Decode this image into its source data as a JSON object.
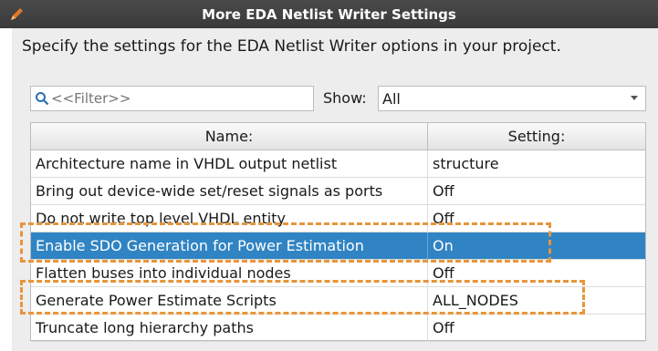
{
  "window": {
    "title": "More EDA Netlist Writer Settings"
  },
  "description": "Specify the settings for the EDA Netlist Writer options in your project.",
  "filter": {
    "placeholder": "<<Filter>>"
  },
  "show": {
    "label": "Show:",
    "selected": "All"
  },
  "table": {
    "columns": {
      "name": "Name:",
      "setting": "Setting:"
    },
    "rows": [
      {
        "name": "Architecture name in VHDL output netlist",
        "setting": "structure",
        "selected": false
      },
      {
        "name": "Bring out device-wide set/reset signals as ports",
        "setting": "Off",
        "selected": false
      },
      {
        "name": "Do not write top level VHDL entity",
        "setting": "Off",
        "selected": false
      },
      {
        "name": "Enable SDO Generation for Power Estimation",
        "setting": "On",
        "selected": true
      },
      {
        "name": "Flatten buses into individual nodes",
        "setting": "Off",
        "selected": false
      },
      {
        "name": "Generate Power Estimate Scripts",
        "setting": "ALL_NODES",
        "selected": false
      },
      {
        "name": "Truncate long hierarchy paths",
        "setting": "Off",
        "selected": false
      }
    ]
  },
  "colors": {
    "selection": "#3084c3",
    "annotation": "#e8953a",
    "titlebar": "#3d3d3d"
  },
  "icons": {
    "title": "pencil-icon",
    "filter": "search-icon",
    "dropdown": "chevron-down-icon"
  }
}
